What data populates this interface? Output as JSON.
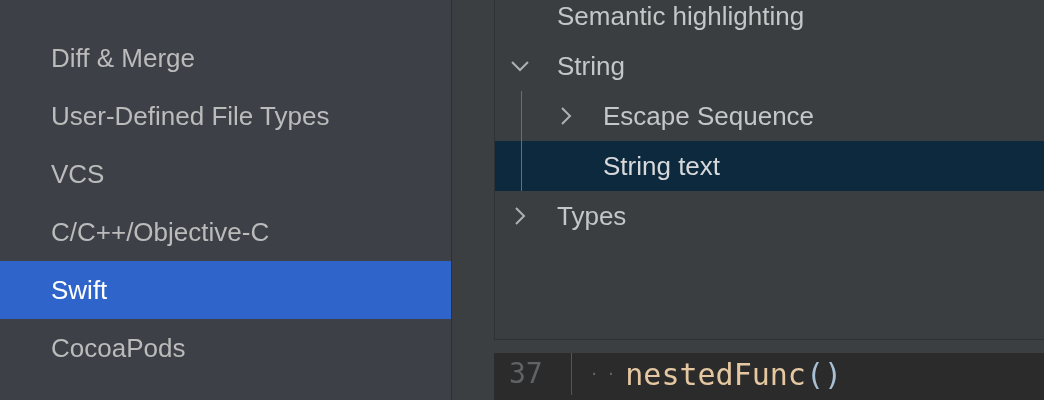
{
  "sidebar": {
    "items": [
      {
        "label": "Diff & Merge",
        "selected": false
      },
      {
        "label": "User-Defined File Types",
        "selected": false
      },
      {
        "label": "VCS",
        "selected": false
      },
      {
        "label": "C/C++/Objective-C",
        "selected": false
      },
      {
        "label": "Swift",
        "selected": true
      },
      {
        "label": "CocoaPods",
        "selected": false
      }
    ]
  },
  "tree": {
    "items": [
      {
        "label": "Semantic highlighting",
        "selected": false
      },
      {
        "label": "String",
        "selected": false,
        "expanded": true,
        "children": [
          {
            "label": "Escape Sequence",
            "selected": false,
            "expanded": false
          },
          {
            "label": "String text",
            "selected": true
          }
        ]
      },
      {
        "label": "Types",
        "selected": false,
        "expanded": false
      }
    ]
  },
  "editor": {
    "lines": [
      {
        "number": "37",
        "indent": "· ·",
        "code": "nestedFunc",
        "parens": "()"
      }
    ]
  }
}
